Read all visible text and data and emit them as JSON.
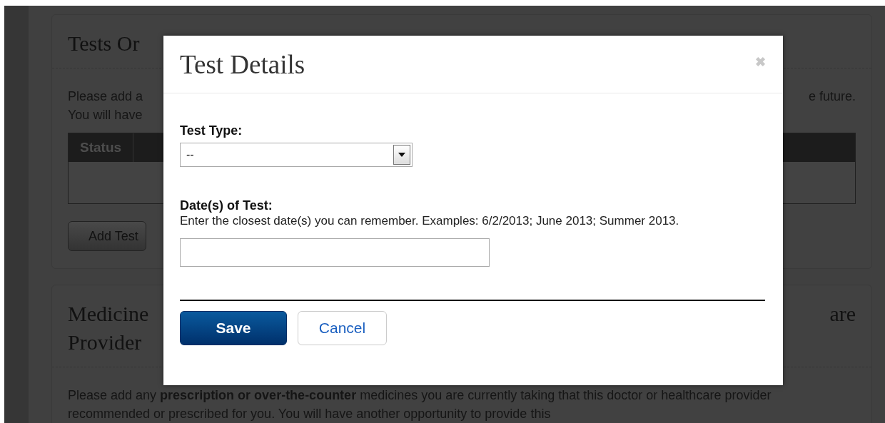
{
  "background": {
    "section_1": {
      "title_fragment": "Tests Or",
      "text_fragments_left": [
        "Please add a",
        "You will have"
      ],
      "text_fragment_right": "e future.",
      "table": {
        "columns": [
          "Status"
        ]
      },
      "add_button": "Add Test"
    },
    "section_2": {
      "title_fragments_left": [
        "Medicine",
        "Provider"
      ],
      "title_fragment_right": "are",
      "description": "Please add any **prescription or over-the-counter** medicines you are currently taking that this doctor or healthcare provider recommended or prescribed for you. You will have another opportunity to provide this"
    }
  },
  "dialog": {
    "title": "Test Details",
    "close": "✖",
    "fields": [
      {
        "kind": "select",
        "label": "Test Type:",
        "value": "--"
      },
      {
        "kind": "text",
        "label": "Date(s) of Test:",
        "hint": "Enter the closest date(s) you can remember. Examples: 6/2/2013; June 2013; Summer 2013."
      }
    ],
    "buttons": [
      {
        "kind": "primary",
        "label": "Save"
      },
      {
        "kind": "secondary",
        "label": "Cancel"
      }
    ]
  }
}
